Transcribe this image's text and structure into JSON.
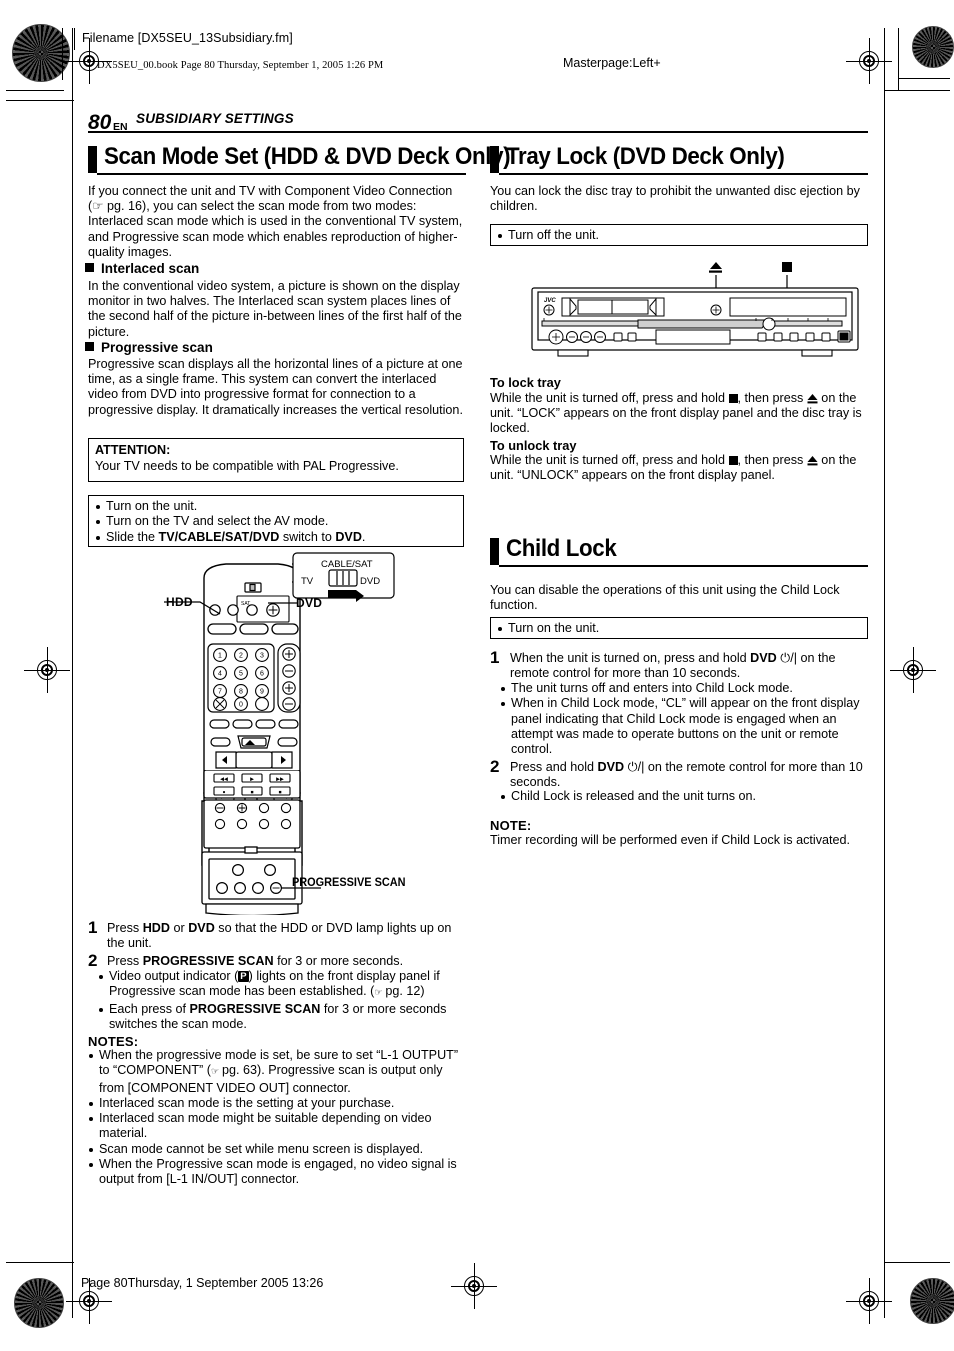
{
  "header": {
    "filename": "Filename [DX5SEU_13Subsidiary.fm]",
    "book_line": "DX5SEU_00.book  Page 80  Thursday, September 1, 2005  1:26 PM",
    "masterpage": "Masterpage:Left+"
  },
  "page": {
    "number": "80",
    "lang": "EN",
    "running_head": "SUBSIDIARY SETTINGS"
  },
  "left_column": {
    "section_title": "Scan Mode Set (HDD & DVD Deck Only)",
    "intro": "If you connect the unit and TV with Component Video Connection (☞ pg. 16), you can select the scan mode from two modes: Interlaced scan mode which is used in the conventional TV system, and Progressive scan mode which enables reproduction of higher-quality images.",
    "sub1_title": "Interlaced scan",
    "sub1_body": "In the conventional video system, a picture is shown on the display monitor in two halves. The Interlaced scan system places lines of the second half of the picture in-between lines of the first half of the picture.",
    "sub2_title": "Progressive scan",
    "sub2_body": "Progressive scan displays all the horizontal lines of a picture at one time, as a single frame. This system can convert the interlaced video from DVD into progressive format for connection to a progressive display. It dramatically increases the vertical resolution.",
    "attention_title": "ATTENTION:",
    "attention_body": "Your TV needs to be compatible with PAL Progressive.",
    "prep_box": [
      "Turn on the unit.",
      "Turn on the TV and select the AV mode.",
      "Slide the TV/CABLE/SAT/DVD switch to DVD."
    ],
    "remote": {
      "callout_cable_sat": "CABLE/SAT",
      "callout_tv": "TV",
      "callout_dvd": "DVD",
      "label_hdd": "HDD",
      "label_dvd": "DVD",
      "label_progressive_scan": "PROGRESSIVE SCAN",
      "keypad": [
        "1",
        "2",
        "3",
        "4",
        "5",
        "6",
        "7",
        "8",
        "9",
        "0"
      ]
    },
    "steps": [
      {
        "num": "1",
        "text": "Press HDD or DVD so that the HDD or DVD lamp lights up on the unit.",
        "bullets": []
      },
      {
        "num": "2",
        "text": "Press PROGRESSIVE SCAN for 3 or more seconds.",
        "bullets": [
          "Video output indicator (P) lights on the front display panel if Progressive scan mode has been established. (☞ pg. 12)",
          "Each press of PROGRESSIVE SCAN for 3 or more seconds switches the scan mode."
        ]
      }
    ],
    "notes_title": "NOTES:",
    "notes": [
      "When the progressive mode is set, be sure to set “L-1 OUTPUT” to “COMPONENT” (☞ pg. 63). Progressive scan is output only from [COMPONENT VIDEO OUT] connector.",
      "Interlaced scan mode is the setting at your purchase.",
      "Interlaced scan mode might be suitable depending on video material.",
      "Scan mode cannot be set while menu screen is displayed.",
      "When the Progressive scan mode is engaged, no video signal is output from [L-1 IN/OUT] connector."
    ]
  },
  "right_column": {
    "tray_lock": {
      "section_title": "Tray Lock (DVD Deck Only)",
      "intro": "You can lock the disc tray to prohibit the unwanted disc ejection by children.",
      "prep_box": [
        "Turn off the unit."
      ],
      "unit_brand": "JVC",
      "callout_eject_icon": "eject-icon",
      "callout_stop_icon": "stop-icon",
      "lock_title": "To lock tray",
      "lock_body": "While the unit is turned off, press and hold ■, then press ⏏ on the unit. “LOCK” appears on the front display panel and the disc tray is locked.",
      "unlock_title": "To unlock tray",
      "unlock_body": "While the unit is turned off, press and hold ■, then press ⏏ on the unit. “UNLOCK” appears on the front display panel."
    },
    "child_lock": {
      "section_title": "Child Lock",
      "intro": "You can disable the operations of this unit using the Child Lock function.",
      "prep_box": [
        "Turn on the unit."
      ],
      "steps": [
        {
          "num": "1",
          "text": "When the unit is turned on, press and hold DVD ⏻/| on the remote control for more than 10 seconds.",
          "bullets": [
            "The unit turns off and enters into Child Lock mode.",
            "When in Child Lock mode, “CL” will appear on the front display panel indicating that Child Lock mode is engaged when an attempt was made to operate buttons on the unit or remote control."
          ]
        },
        {
          "num": "2",
          "text": "Press and hold DVD ⏻/| on the remote control for more than 10 seconds.",
          "bullets": [
            "Child Lock is released and the unit turns on."
          ]
        }
      ],
      "note_title": "NOTE:",
      "note_body": "Timer recording will be performed even if Child Lock is activated."
    }
  },
  "footer": {
    "text": "Page 80Thursday, 1 September 2005  13:26"
  },
  "colors": {
    "ink": "#000000",
    "paper": "#ffffff"
  }
}
